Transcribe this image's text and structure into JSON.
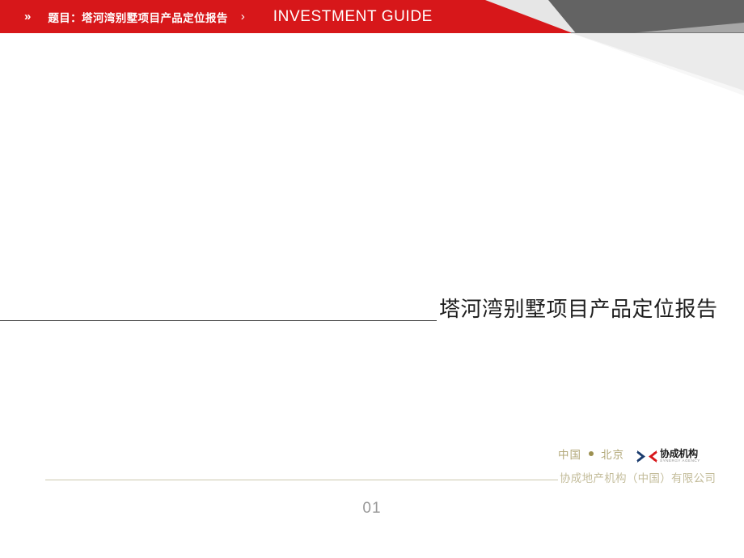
{
  "header": {
    "chevron_double": "»",
    "chevron_single": "›",
    "subject_label": "题目：塔河湾别墅项目产品定位报告",
    "guide_label": "INVESTMENT GUIDE",
    "bar_color": "#D7171A",
    "text_color": "#FFFFFF",
    "band_dark_gray": "#636363",
    "band_light_gray": "#E8E8E8",
    "band_mid_gray": "#C9C9C9"
  },
  "main": {
    "title": "塔河湾别墅项目产品定位报告",
    "title_color": "#1D1D1D",
    "rule_color": "#3C3C3C"
  },
  "footer": {
    "country": "中国",
    "separator_dot": "●",
    "city": "北京",
    "company_full": "协成地产机构（中国）有限公司",
    "location_color": "#B3A97A",
    "company_color": "#C3BC9A",
    "rule_color": "#CDC8AE",
    "logo": {
      "name_cn": "协成机构",
      "name_en": "SYNERGY AGENCY",
      "mark_color_left": "#1B3C6E",
      "mark_color_right": "#D7171A"
    }
  },
  "page": {
    "number": "01",
    "number_color": "#9A9A9A"
  }
}
